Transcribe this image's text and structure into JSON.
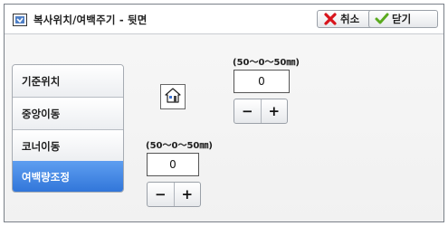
{
  "window": {
    "title": "복사위치/여백주기 - 뒷면",
    "title_icon": "document-icon"
  },
  "toolbar": {
    "cancel_label": "취소",
    "cancel_icon": "red-x-icon",
    "close_label": "닫기",
    "close_icon": "green-check-icon"
  },
  "tabs": [
    {
      "label": "기준위치",
      "active": false
    },
    {
      "label": "중앙이동",
      "active": false
    },
    {
      "label": "코너이동",
      "active": false
    },
    {
      "label": "여백량조정",
      "active": true
    }
  ],
  "home_button": {
    "icon": "house-icon"
  },
  "vertical_adjust": {
    "range_text": "(50～0～50㎜)",
    "value": "0",
    "minus_label": "−",
    "plus_label": "+"
  },
  "horizontal_adjust": {
    "range_text": "(50～0～50㎜)",
    "value": "0",
    "minus_label": "−",
    "plus_label": "+"
  },
  "colors": {
    "active_tab": "#3c82e0",
    "cancel_icon": "#d8141c",
    "close_icon": "#5aaa1e"
  }
}
